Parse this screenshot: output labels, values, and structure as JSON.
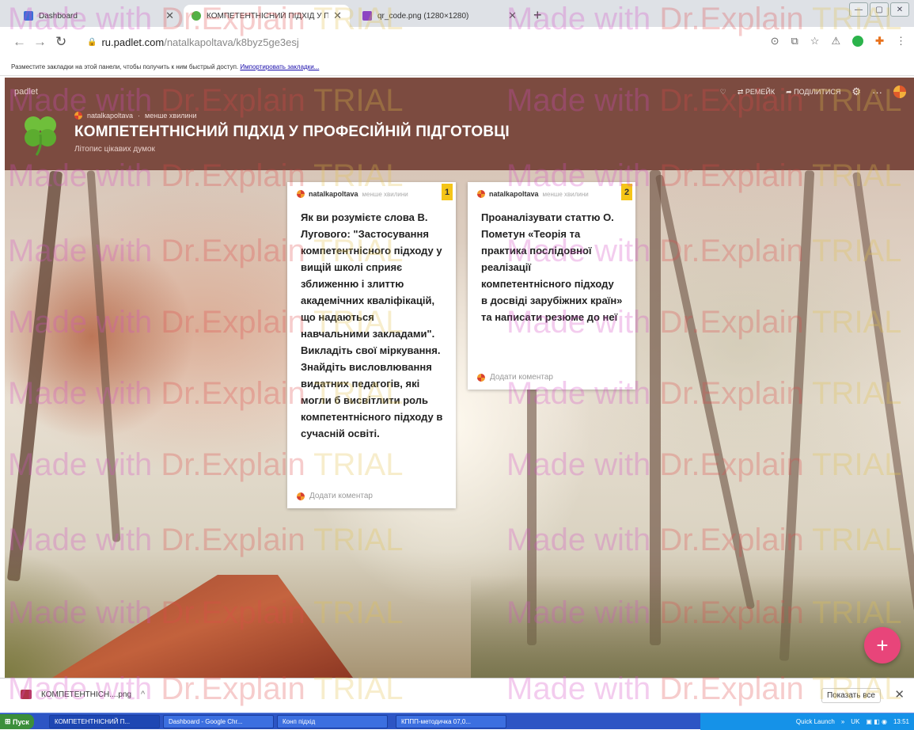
{
  "browser": {
    "tabs": [
      {
        "title": "Dashboard",
        "favicon_color": "#3b6fd8"
      },
      {
        "title": "КОМПЕТЕНТНІСНИЙ ПІДХІД У ПРО",
        "favicon_color": "#54b045"
      },
      {
        "title": "qr_code.png (1280×1280)",
        "favicon_color": "#8c44c2"
      }
    ],
    "new_tab": "+",
    "url_host": "ru.padlet.com",
    "url_path": "/natalkapoltava/k8byz5ge3esj",
    "bookmarks_hint": "Разместите закладки на этой панели, чтобы получить к ним быстрый доступ.",
    "bookmarks_link": "Импортировать закладки..."
  },
  "padlet": {
    "logo": "padlet",
    "actions": {
      "remake": "РЕМЕЙК",
      "share": "ПОДІЛИТИСЯ"
    },
    "author": "natalkapoltava",
    "time": "менше хвилини",
    "title": "КОМПЕТЕНТНІСНИЙ ПІДХІД У ПРОФЕСІЙНІЙ ПІДГОТОВЦІ",
    "subtitle": "Літопис цікавих думок",
    "posts": [
      {
        "author": "natalkapoltava",
        "time": "менше хвилини",
        "number": "1",
        "body": "Як ви розумієте слова В. Лугового: \"Застосування компетентнісного підходу у вищій школі сприяє зближенню і злиттю академічних кваліфікацій, що надаються навчальними закладами\". Викладіть свої міркування. Знайдіть висловлювання видатних педагогів, які могли б висвітлити роль компетентнісного підходу в сучасній освіті.",
        "comment": "Додати коментар"
      },
      {
        "author": "natalkapoltava",
        "time": "менше хвилини",
        "number": "2",
        "body": "Проаналізувати статтю О. Пометун «Теорія та практика послідовної реалізації компетентнісного підходу в досвіді зарубіжних країн» та написати резюме до неї",
        "comment": "Додати коментар"
      }
    ],
    "fab": "+"
  },
  "download": {
    "filename": "КОМПЕТЕНТНІСН....png",
    "show_all": "Показать все"
  },
  "taskbar": {
    "start": "Пуск",
    "tasks": [
      "КОМПЕТЕНТНІСНИЙ П...",
      "Dashboard - Google Chr...",
      "Конп підхід",
      "КППП-методичка 07,0..."
    ],
    "quick_launch": "Quick Launch",
    "lang": "UK",
    "clock": "13:51"
  },
  "watermark": {
    "a": "Made with ",
    "b": "Dr.Explain",
    "c": " TRIAL"
  },
  "colors": {
    "header_bg": "#7c4b40",
    "number_badge": "#f5c518",
    "fab": "#e8457a"
  }
}
